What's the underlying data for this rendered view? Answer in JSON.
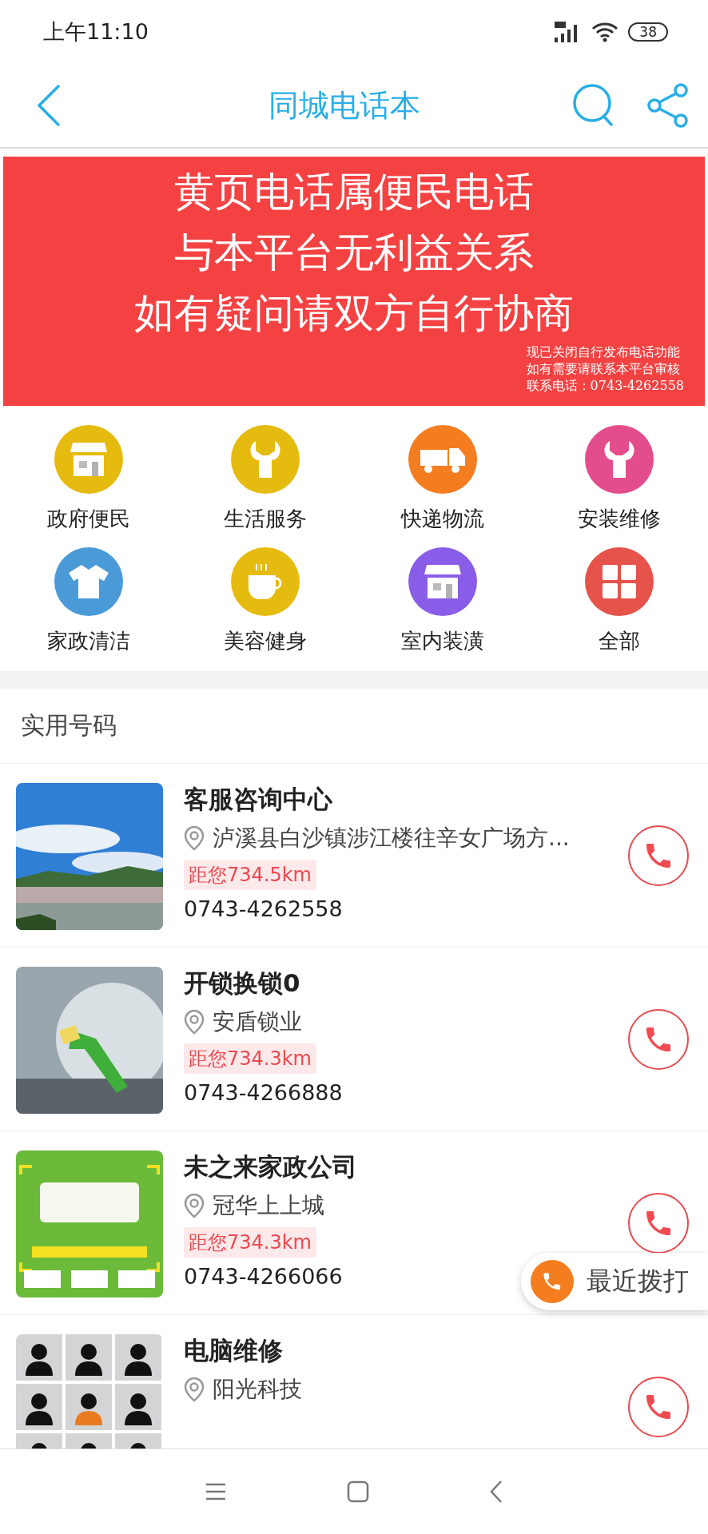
{
  "status_bar": {
    "time": "上午11:10",
    "battery": "38"
  },
  "header": {
    "title": "同城电话本"
  },
  "banner": {
    "headline": [
      "黄页电话属便民电话",
      "与本平台无利益关系",
      "如有疑问请双方自行协商"
    ],
    "notes": [
      "现已关闭自行发布电话功能",
      "如有需要请联系本平台审核",
      "联系电话：0743-4262558"
    ]
  },
  "categories": [
    {
      "label": "政府便民",
      "color": "#e6bb10",
      "kind": "store"
    },
    {
      "label": "生活服务",
      "color": "#e6bb10",
      "kind": "wrench"
    },
    {
      "label": "快递物流",
      "color": "#f47d20",
      "kind": "truck"
    },
    {
      "label": "安装维修",
      "color": "#e44d8c",
      "kind": "wrench"
    },
    {
      "label": "家政清洁",
      "color": "#4a9ad8",
      "kind": "shirt"
    },
    {
      "label": "美容健身",
      "color": "#e6bb10",
      "kind": "cup"
    },
    {
      "label": "室内装潢",
      "color": "#8a5de8",
      "kind": "store"
    },
    {
      "label": "全部",
      "color": "#e5534b",
      "kind": "grid"
    }
  ],
  "section": {
    "title": "实用号码"
  },
  "listings": [
    {
      "name": "客服咨询中心",
      "address": "泸溪县白沙镇涉江楼往辛女广场方...",
      "distance": "距您734.5km",
      "phone": "0743-4262558"
    },
    {
      "name": "开锁换锁0",
      "address": "安盾锁业",
      "distance": "距您734.3km",
      "phone": "0743-4266888"
    },
    {
      "name": "未之来家政公司",
      "address": "冠华上上城",
      "distance": "距您734.3km",
      "phone": "0743-4266066"
    },
    {
      "name": "电脑维修",
      "address": "阳光科技"
    }
  ],
  "floating_button": {
    "label": "最近拨打"
  }
}
